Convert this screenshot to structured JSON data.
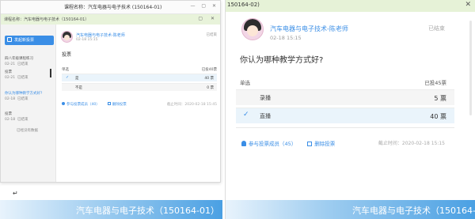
{
  "left": {
    "title": "课程名称：汽车电器与电子技术 (150164-01)",
    "window_controls": "— ▢ ✕",
    "tab_text": "课程名称：汽车电器与电子技术（150164-01）",
    "tab_controls": "▢ ✕",
    "new_vote_button": "发起新投票",
    "sidebar": {
      "q1": "四八年级课程练习",
      "q1_date": "02-21",
      "q1_status": "已结束",
      "q2": "投票",
      "q2_date": "02-21",
      "q2_status": "已结束",
      "q3": "你认为哪种教学方式好?",
      "q3_date": "02-18",
      "q3_status": "已结束",
      "q4": "投票",
      "q4_date": "02-18",
      "q4_status": "已结束",
      "more": "已经没有数据"
    },
    "poll": {
      "poster": "汽车电器与电子技术-陈老师",
      "time": "02-18 15:15",
      "status": "已结束",
      "question": "投票",
      "type_label": "单选",
      "votes_header": "已投40票",
      "options": [
        {
          "label": "是",
          "votes": "40 票",
          "checked": true
        },
        {
          "label": "不是",
          "votes": "0 票",
          "checked": false
        }
      ],
      "participants_link": "参与投票成员（40）",
      "delete_link": "删除投票",
      "end_time": "截止时间：2020-02-18 15:45"
    },
    "return_mark": "↵",
    "banner": "汽车电器与电子技术（150164-01）"
  },
  "right": {
    "topbar_text": "150164-02)",
    "topbar_close": "✕",
    "poll": {
      "poster": "汽车电器与电子技术-陈老师",
      "time": "02-18 15:15",
      "status": "已结束",
      "question": "你认为哪种教学方式好?",
      "type_label": "单选",
      "votes_header": "已投45票",
      "options": [
        {
          "label": "录播",
          "votes": "5 票",
          "checked": false
        },
        {
          "label": "直播",
          "votes": "40 票",
          "checked": true
        }
      ],
      "participants_link": "参与投票成员（45）",
      "delete_link": "删除投票",
      "end_time": "截止时间：2020-02-18 15:15"
    },
    "banner": "汽车电器与电子技术（150164-"
  },
  "colors": {
    "accent": "#3a8ee6",
    "tab_bar": "#e6f2d7",
    "selected_row": "#eaf4fb",
    "banner_end": "#4aa0e3"
  }
}
